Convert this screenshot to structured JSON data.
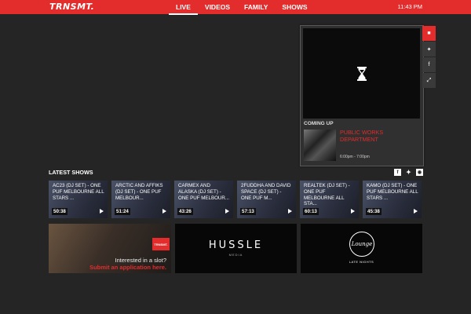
{
  "header": {
    "logo": "TRNSMT.",
    "nav": [
      "LIVE",
      "VIDEOS",
      "FAMILY",
      "SHOWS"
    ],
    "active_nav": "LIVE",
    "time": "11:43 PM"
  },
  "player": {
    "coming_up_label": "COMING UP",
    "show_title": "PUBLIC WORKS DEPARTMENT",
    "show_time": "6:00pm - 7:00pm",
    "side_tabs": [
      "chat-icon",
      "twitter-icon",
      "facebook-icon",
      "expand-icon"
    ]
  },
  "latest": {
    "heading": "LATEST SHOWS",
    "social": [
      "facebook-icon",
      "twitter-icon",
      "instagram-icon"
    ],
    "shows": [
      {
        "title": "AC23 (DJ SET) - ONE PUF MELBOURNE ALL STARS ...",
        "duration": "50:38"
      },
      {
        "title": "ARCTIC AND AFFIKS (DJ SET) - ONE PUF MELBOUR...",
        "duration": "51:24"
      },
      {
        "title": "CARMEX AND ALASKA (DJ SET) - ONE PUF MELBOUR...",
        "duration": "43:26"
      },
      {
        "title": "2FUDDHA AND DAVID SPACE (DJ SET) - ONE PUF M...",
        "duration": "57:13"
      },
      {
        "title": "REALTEK (DJ SET) - ONE PUF MELBOURNE ALL STA...",
        "duration": "60:13"
      },
      {
        "title": "KAMO (DJ SET) - ONE PUF MELBOURNE ALL STARS ...",
        "duration": "45:38"
      }
    ]
  },
  "banners": {
    "slot_mini_logo": "TRNSMT.",
    "slot_question": "Interested in a slot?",
    "slot_cta": "Submit an application here.",
    "hussle_name": "HUSSLE",
    "hussle_sub": "MEDIA",
    "lounge_name": "Lounge",
    "lounge_sub": "LATE NIGHTS"
  },
  "colors": {
    "accent": "#e32c2c",
    "background": "#252525"
  }
}
